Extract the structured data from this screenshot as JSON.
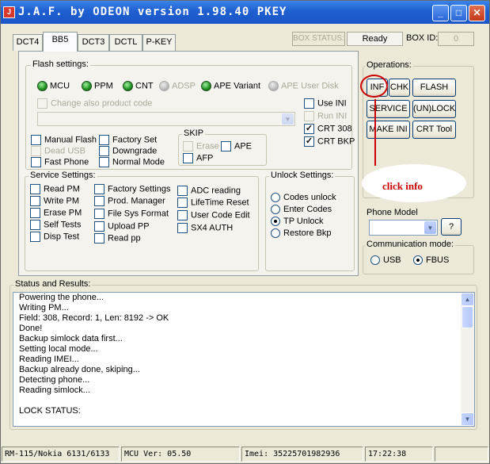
{
  "window": {
    "title": "J.A.F. by ODEON version 1.98.40 PKEY",
    "minimize": "_",
    "maximize": "□",
    "close": "✕"
  },
  "tabs": [
    "DCT4",
    "BB5",
    "DCT3",
    "DCTL",
    "P-KEY"
  ],
  "status": {
    "box_status_label": "BOX STATUS:",
    "box_status_value": "Ready",
    "box_id_label": "BOX ID:",
    "box_id_value": "0"
  },
  "flash_settings": {
    "label": "Flash settings:",
    "leds": [
      "MCU",
      "PPM",
      "CNT",
      "ADSP",
      "APE Variant",
      "APE User Disk"
    ],
    "change_product_code": "Change also product code",
    "ini_options": [
      "Use INI",
      "Run INI",
      "CRT 308",
      "CRT BKP"
    ],
    "options_col1": [
      "Manual Flash",
      "Dead USB",
      "Fast Phone"
    ],
    "options_col2": [
      "Factory Set",
      "Downgrade",
      "Normal Mode"
    ],
    "skip_label": "SKIP",
    "skip_options": [
      "Erase",
      "APE",
      "AFP"
    ]
  },
  "service_settings": {
    "label": "Service Settings:",
    "col1": [
      "Read PM",
      "Write PM",
      "Erase PM",
      "Self Tests",
      "Disp Test"
    ],
    "col2": [
      "Factory Settings",
      "Prod. Manager",
      "File Sys Format",
      "Upload PP",
      "Read pp"
    ],
    "col3": [
      "ADC reading",
      "LifeTime Reset",
      "User Code Edit",
      "SX4 AUTH"
    ]
  },
  "unlock_settings": {
    "label": "Unlock Settings:",
    "options": [
      "Codes unlock",
      "Enter Codes",
      "TP Unlock",
      "Restore Bkp"
    ],
    "selected": "TP Unlock"
  },
  "operations": {
    "label": "Operations:",
    "buttons": [
      "INF",
      "CHK",
      "FLASH",
      "SERVICE",
      "(UN)LOCK",
      "MAKE INI",
      "CRT Tool"
    ],
    "annotation": "click info"
  },
  "phone_model": {
    "label": "Phone Model",
    "help": "?"
  },
  "communication": {
    "label": "Communication mode:",
    "options": [
      "USB",
      "FBUS"
    ],
    "selected": "FBUS"
  },
  "status_results": {
    "label": "Status and Results:",
    "lines": [
      "Powering the phone...",
      "Writing PM...",
      "Field: 308, Record: 1, Len: 8192 -> OK",
      "Done!",
      "Backup simlock data first...",
      "Setting local mode...",
      "Reading IMEI...",
      "Backup already done, skiping...",
      "Detecting phone...",
      "Reading simlock...",
      "",
      "LOCK STATUS:"
    ]
  },
  "statusbar": {
    "model": "RM-115/Nokia 6131/6133",
    "mcu": "MCU Ver: 05.50",
    "imei": "Imei: 35225701982936",
    "time": "17:22:38"
  },
  "colors": {
    "titlebar": "#1f5fd0",
    "annotation": "#cc0000"
  }
}
